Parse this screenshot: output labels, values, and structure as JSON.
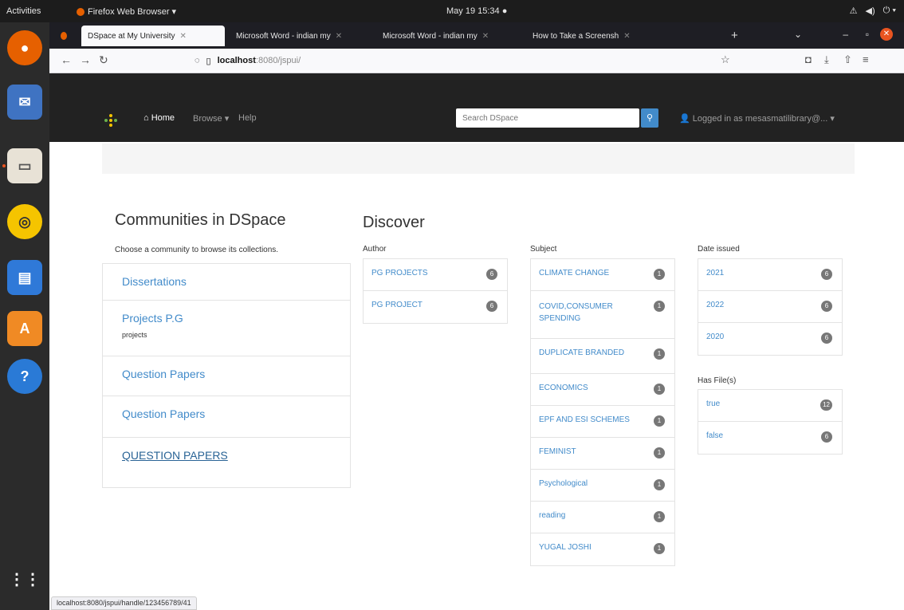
{
  "topbar": {
    "activities": "Activities",
    "app_menu": "Firefox Web Browser ▾",
    "clock": "May 19  15:34  ●",
    "tray": [
      "⚠",
      "◀)",
      "⏻ ▾"
    ]
  },
  "browser": {
    "tabs": [
      {
        "label": "DSpace at My University",
        "active": true
      },
      {
        "label": "Microsoft Word - indian my",
        "active": false
      },
      {
        "label": "Microsoft Word - indian my",
        "active": false
      },
      {
        "label": "How to Take a Screensh",
        "active": false
      }
    ],
    "url_host": "localhost",
    "url_rest": ":8080/jspui/",
    "status_url": "localhost:8080/jspui/handle/123456789/41"
  },
  "dspace_nav": {
    "home": "Home",
    "browse": "Browse ▾",
    "help": "Help",
    "search_placeholder": "Search DSpace",
    "logged_in": "Logged in as mesasmatilibrary@... ▾"
  },
  "communities": {
    "title": "Communities in DSpace",
    "subtitle": "Choose a community to browse its collections.",
    "items": [
      {
        "name": "Dissertations",
        "desc": ""
      },
      {
        "name": "Projects P.G",
        "desc": "projects"
      },
      {
        "name": "Question Papers",
        "desc": ""
      },
      {
        "name": "Question Papers",
        "desc": ""
      },
      {
        "name": "QUESTION PAPERS",
        "desc": ""
      }
    ]
  },
  "discover": {
    "title": "Discover",
    "author": {
      "heading": "Author",
      "items": [
        {
          "label": "PG PROJECTS",
          "count": "6"
        },
        {
          "label": "PG PROJECT",
          "count": "6"
        }
      ]
    },
    "subject": {
      "heading": "Subject",
      "items": [
        {
          "label": "CLIMATE CHANGE",
          "count": "1"
        },
        {
          "label": "COVID,CONSUMER SPENDING",
          "count": "1"
        },
        {
          "label": "DUPLICATE BRANDED",
          "count": "1"
        },
        {
          "label": "ECONOMICS",
          "count": "1"
        },
        {
          "label": "EPF AND ESI SCHEMES",
          "count": "1"
        },
        {
          "label": "FEMINIST",
          "count": "1"
        },
        {
          "label": "Psychological",
          "count": "1"
        },
        {
          "label": "reading",
          "count": "1"
        },
        {
          "label": "YUGAL JOSHI",
          "count": "1"
        }
      ]
    },
    "date_issued": {
      "heading": "Date issued",
      "items": [
        {
          "label": "2021",
          "count": "6"
        },
        {
          "label": "2022",
          "count": "6"
        },
        {
          "label": "2020",
          "count": "6"
        }
      ]
    },
    "has_files": {
      "heading": "Has File(s)",
      "items": [
        {
          "label": "true",
          "count": "12"
        },
        {
          "label": "false",
          "count": "6"
        }
      ]
    }
  },
  "colors": {
    "link": "#428bca",
    "navbar": "#222222",
    "badge": "#777777"
  }
}
